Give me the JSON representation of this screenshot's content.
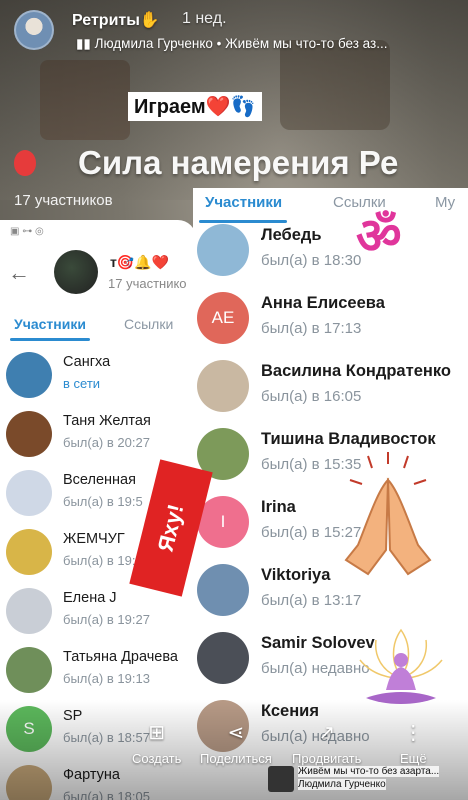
{
  "story": {
    "channel_name": "Ретриты✋",
    "time_ago": "1 нед.",
    "music": "Людмила Гурченко • Живём мы что-то без аз...",
    "sticker_play": "Играем❤️👣",
    "big_title": "Сила намерения Ре",
    "members_caption": "17 участников"
  },
  "right_card": {
    "tabs": [
      "Участники",
      "Ссылки",
      "Му"
    ],
    "members": [
      {
        "name": "Лебедь",
        "status": "был(а) в 18:30",
        "avatar_color": "#8fb8d6",
        "letter": ""
      },
      {
        "name": "Анна Елисеева",
        "status": "был(а) в 17:13",
        "avatar_color": "#e0675a",
        "letter": "АЕ"
      },
      {
        "name": "Василина Кондратенко",
        "status": "был(а) в 16:05",
        "avatar_color": "#c9b8a2",
        "letter": ""
      },
      {
        "name": "Тишина Владивосток",
        "status": "был(а) в 15:35",
        "avatar_color": "#7d9a5a",
        "letter": ""
      },
      {
        "name": "Irina",
        "status": "был(а) в 15:27",
        "avatar_color": "#ef6f8e",
        "letter": "I"
      },
      {
        "name": "Viktoriya",
        "status": "был(а) в 13:17",
        "avatar_color": "#6f8fb0",
        "letter": ""
      },
      {
        "name": "Samir Solovev",
        "status": "был(а) недавно",
        "avatar_color": "#4b4f57",
        "letter": ""
      },
      {
        "name": "Ксения",
        "status": "был(а) недавно",
        "avatar_color": "#b79a86",
        "letter": ""
      }
    ]
  },
  "left_card": {
    "chat_title": "т🎯🔔❤️",
    "chat_subtitle": "17 участнико",
    "tabs": [
      "Участники",
      "Ссылки"
    ],
    "members": [
      {
        "name": "Сангха",
        "status": "в сети",
        "online": true,
        "avatar_color": "#3f7fb0",
        "letter": ""
      },
      {
        "name": "Таня Желтая",
        "status": "был(а) в 20:27",
        "online": false,
        "avatar_color": "#7a4a2a",
        "letter": ""
      },
      {
        "name": "Вселенная",
        "status": "был(а) в 19:5",
        "online": false,
        "avatar_color": "#cfd8e6",
        "letter": ""
      },
      {
        "name": "ЖЕМЧУГ",
        "status": "был(а) в 19:",
        "online": false,
        "avatar_color": "#d8b548",
        "letter": ""
      },
      {
        "name": "Елена J",
        "status": "был(а) в 19:27",
        "online": false,
        "avatar_color": "#c9ced6",
        "letter": ""
      },
      {
        "name": "Татьяна Драчева",
        "status": "был(а) в 19:13",
        "online": false,
        "avatar_color": "#6f8f5a",
        "letter": ""
      },
      {
        "name": "SP",
        "status": "был(а) в 18:57",
        "online": false,
        "avatar_color": "#5cb85c",
        "letter": "S"
      },
      {
        "name": "Фартуна",
        "status": "был(а) в 18:05",
        "online": false,
        "avatar_color": "#c7a87a",
        "letter": ""
      }
    ]
  },
  "stickers": {
    "yahoo": "Яху!",
    "om": "ॐ"
  },
  "actions": [
    {
      "label": "Создать",
      "icon": "plus-square-icon"
    },
    {
      "label": "Поделиться",
      "icon": "share-icon"
    },
    {
      "label": "Продвигать",
      "icon": "trend-icon"
    },
    {
      "label": "Ещё",
      "icon": "more-icon"
    }
  ],
  "music_tag": {
    "line1": "Живём мы что-то без азарта...",
    "line2": "Людмила Гурченко"
  }
}
